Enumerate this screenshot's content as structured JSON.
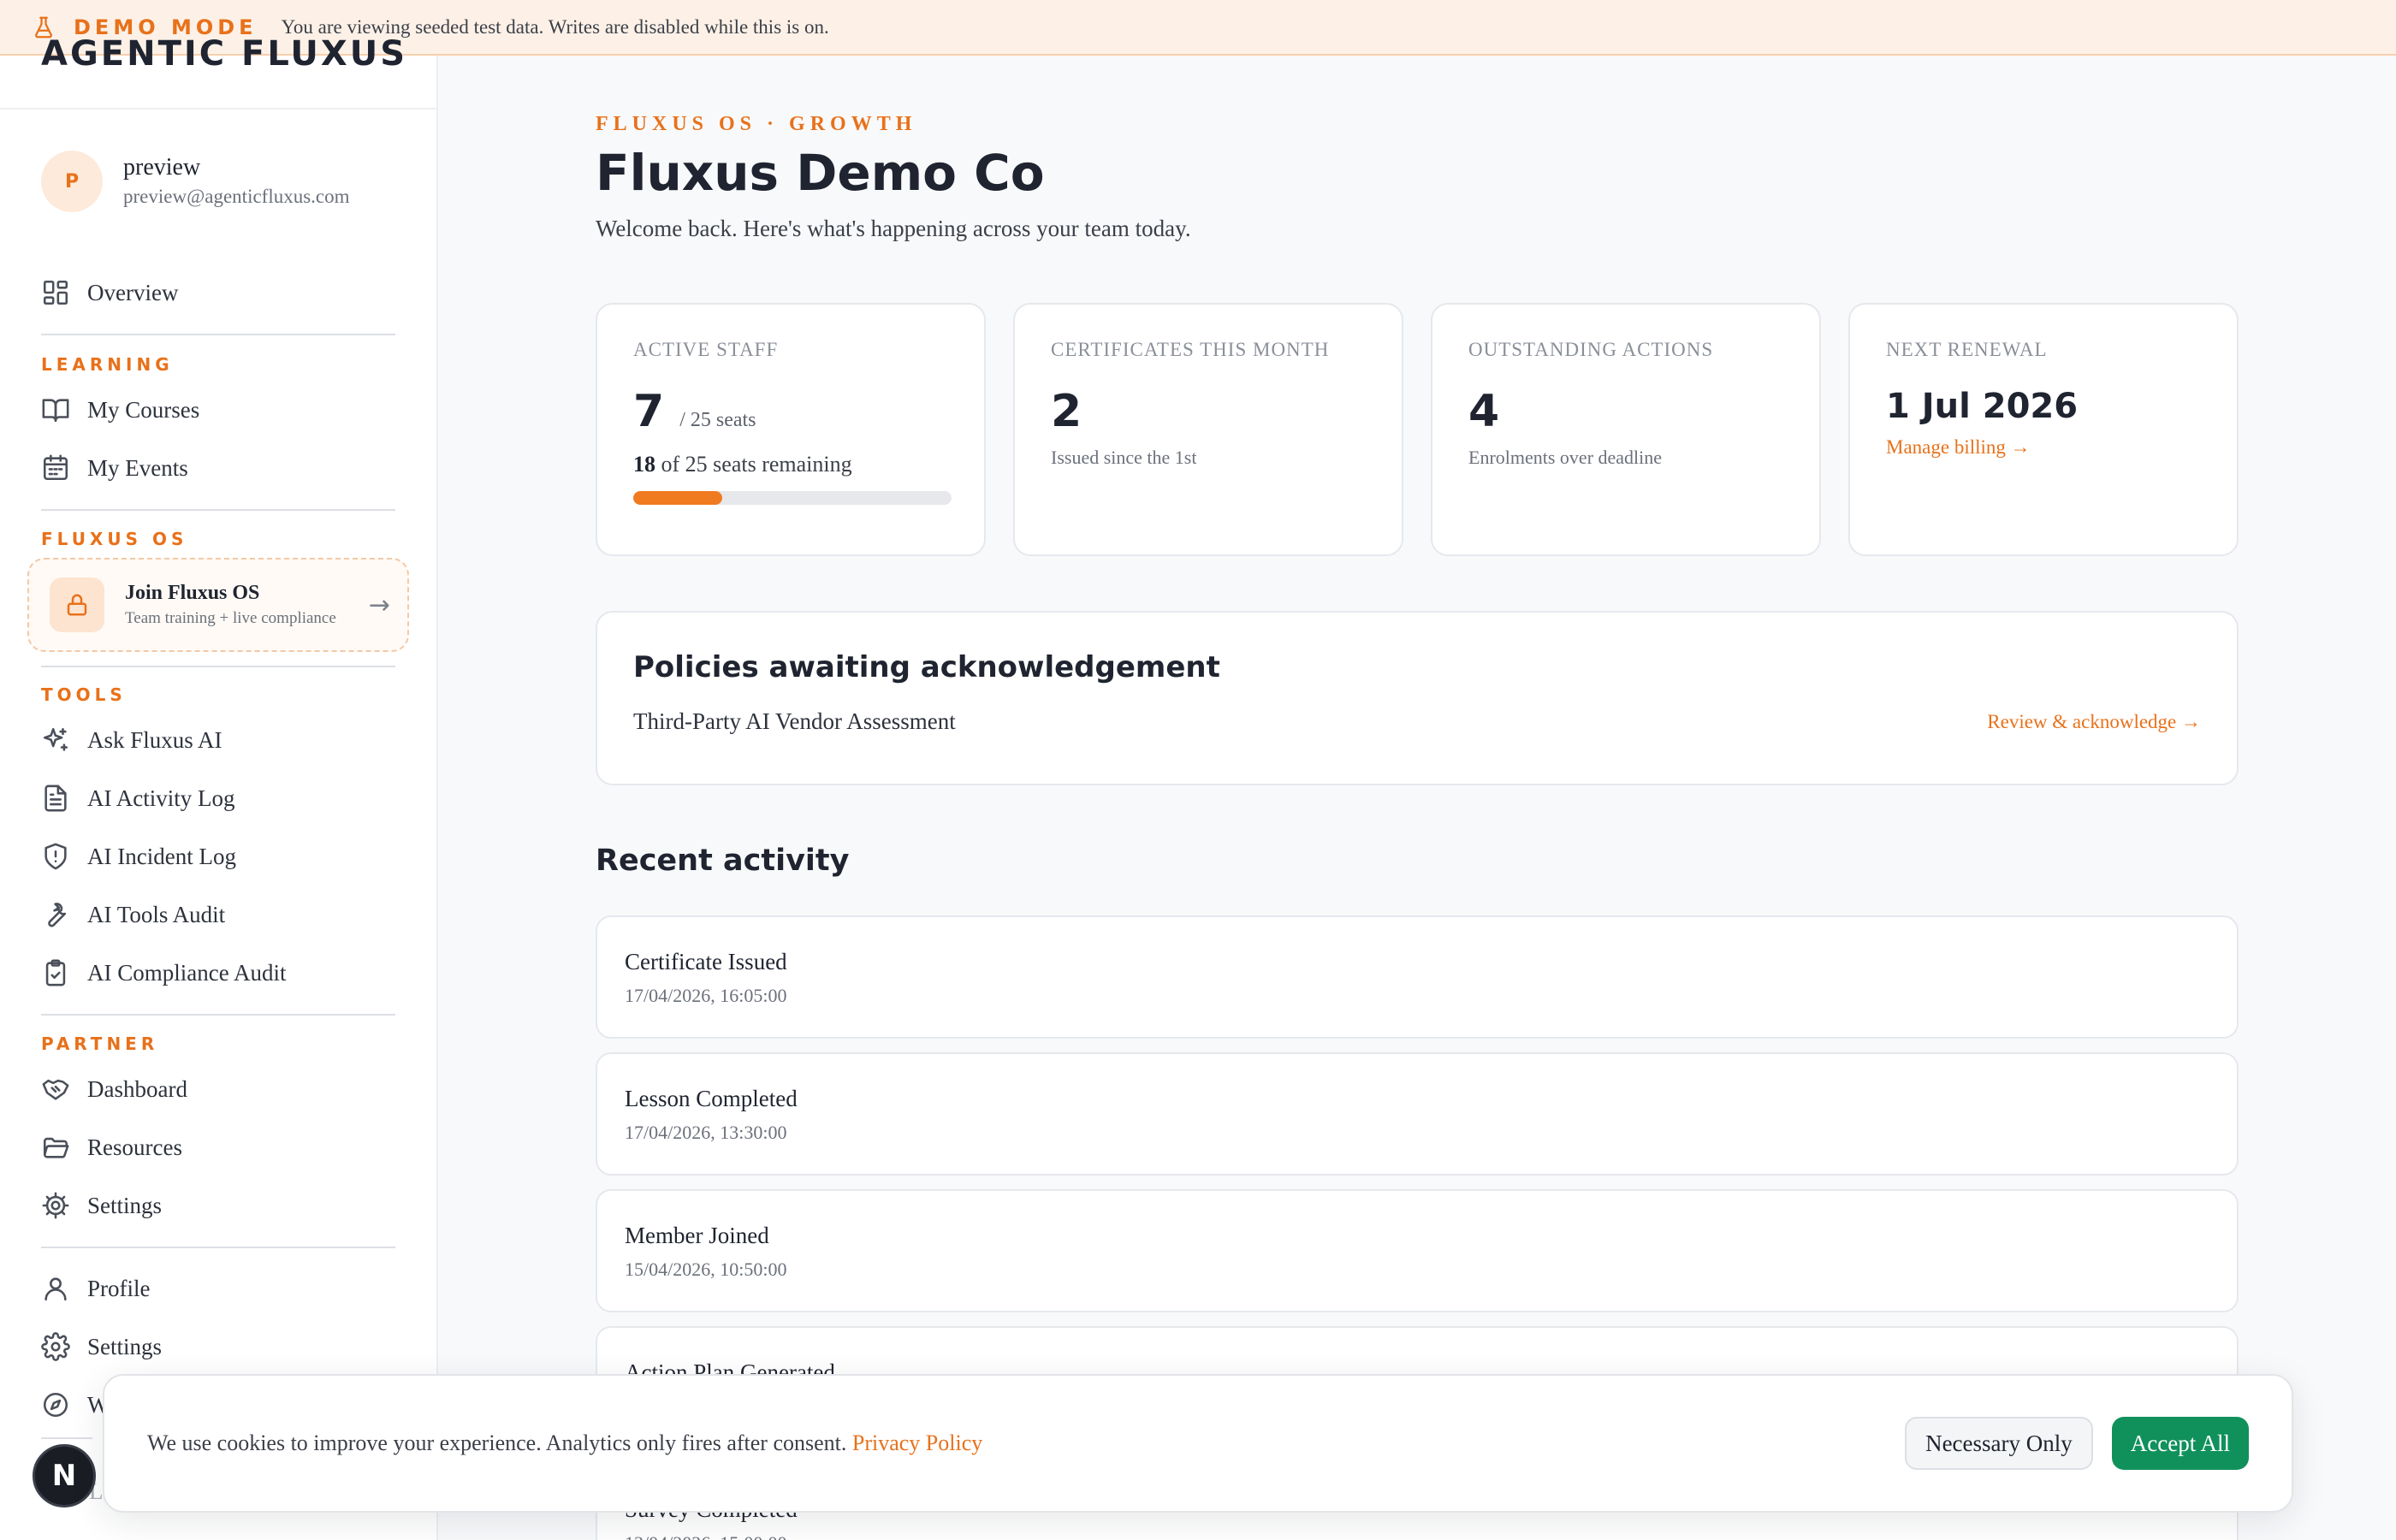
{
  "banner": {
    "mode": "DEMO MODE",
    "message": "You are viewing seeded test data. Writes are disabled while this is on."
  },
  "sidebar": {
    "brand": "AGENTIC FLUXUS",
    "user": {
      "initial": "P",
      "name": "preview",
      "email": "preview@agenticfluxus.com"
    },
    "overview": "Overview",
    "sections": {
      "learning": "LEARNING",
      "fluxus_os": "FLUXUS OS",
      "tools": "TOOLS",
      "partner": "PARTNER"
    },
    "learning_items": [
      "My Courses",
      "My Events"
    ],
    "join": {
      "title": "Join Fluxus OS",
      "subtitle": "Team training + live compliance"
    },
    "tools_items": [
      "Ask Fluxus AI",
      "AI Activity Log",
      "AI Incident Log",
      "AI Tools Audit",
      "AI Compliance Audit"
    ],
    "partner_items": [
      "Dashboard",
      "Resources",
      "Settings"
    ],
    "account_items": [
      "Profile",
      "Settings",
      "W"
    ],
    "logout": "Log out",
    "next_badge": "N"
  },
  "header": {
    "eyebrow": "FLUXUS OS · GROWTH",
    "title": "Fluxus Demo Co",
    "welcome": "Welcome back. Here's what's happening across your team today."
  },
  "stats": {
    "active_staff": {
      "label": "ACTIVE STAFF",
      "value": "7",
      "suffix": "/ 25 seats",
      "remaining_count": "18",
      "remaining_text": "of 25 seats remaining",
      "fill_fraction": 0.28
    },
    "certificates": {
      "label": "CERTIFICATES THIS MONTH",
      "value": "2",
      "sub": "Issued since the 1st"
    },
    "outstanding": {
      "label": "OUTSTANDING ACTIONS",
      "value": "4",
      "sub": "Enrolments over deadline"
    },
    "renewal": {
      "label": "NEXT RENEWAL",
      "value": "1 Jul 2026",
      "link": "Manage billing →"
    }
  },
  "policies": {
    "title": "Policies awaiting acknowledgement",
    "item": "Third-Party AI Vendor Assessment",
    "action": "Review & acknowledge →"
  },
  "activity": {
    "title": "Recent activity",
    "items": [
      {
        "title": "Certificate Issued",
        "time": "17/04/2026, 16:05:00"
      },
      {
        "title": "Lesson Completed",
        "time": "17/04/2026, 13:30:00"
      },
      {
        "title": "Member Joined",
        "time": "15/04/2026, 10:50:00"
      },
      {
        "title": "Action Plan Generated",
        "time": ""
      },
      {
        "title": "Survey Completed",
        "time": "13/04/2026, 15:00:00"
      }
    ]
  },
  "cookie": {
    "text": "We use cookies to improve your experience. Analytics only fires after consent.",
    "privacy": "Privacy Policy",
    "necessary": "Necessary Only",
    "accept": "Accept All"
  },
  "colors": {
    "accent": "#e8711a",
    "accept": "#10915b"
  }
}
